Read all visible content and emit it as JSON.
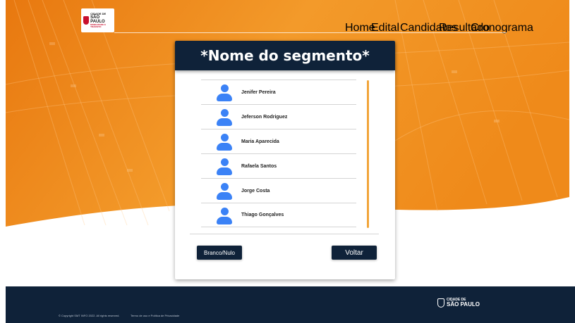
{
  "header": {
    "logo": {
      "line1": "CIDADE DE",
      "line2": "SÃO PAULO",
      "line3": "MOBILIDADE E TRANSITO"
    },
    "nav": [
      {
        "label": "Home"
      },
      {
        "label": "Edital"
      },
      {
        "label": "Candidatos"
      },
      {
        "label": "Resultado"
      },
      {
        "label": "Cronograma"
      }
    ]
  },
  "card": {
    "title": "*Nome do segmento*",
    "candidates": [
      {
        "name": "Jenifer Pereira",
        "icon": "user-avatar-icon"
      },
      {
        "name": "Jeferson Rodriguez",
        "icon": "user-avatar-icon"
      },
      {
        "name": "Maria Aparecida",
        "icon": "user-avatar-icon"
      },
      {
        "name": "Rafaela Santos",
        "icon": "user-avatar-icon"
      },
      {
        "name": "Jorge Costa",
        "icon": "user-avatar-icon"
      },
      {
        "name": "Thiago Gonçalves",
        "icon": "user-avatar-icon"
      }
    ],
    "buttons": {
      "blank": "Branco/Nulo",
      "back": "Voltar"
    }
  },
  "footer": {
    "copyright": "© Copyright SMT INFO 2022. All rights reserved.",
    "terms": "Termo de uso e Política de Privacidade",
    "logo": {
      "line1": "CIDADE DE",
      "line2": "SÃO PAULO"
    }
  },
  "colors": {
    "navy": "#0f2239",
    "orange": "#f28a1c",
    "avatar_blue": "#3b82f6",
    "scrollbar": "#f2a53a"
  }
}
